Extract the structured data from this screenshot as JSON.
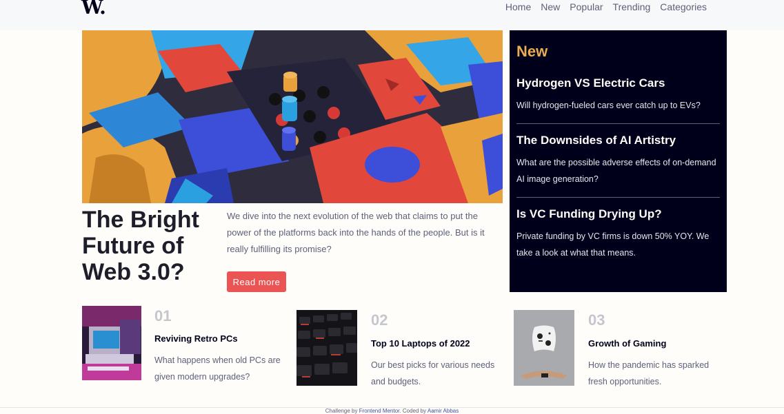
{
  "header": {
    "logo": "W.",
    "nav": [
      "Home",
      "New",
      "Popular",
      "Trending",
      "Categories"
    ]
  },
  "hero": {
    "title": "The Bright Future of Web 3.0?",
    "description": "We dive into the next evolution of the web that claims to put the power of the platforms back into the hands of the people. But is it really fulfilling its promise?",
    "button": "Read more"
  },
  "new_panel": {
    "heading": "New",
    "items": [
      {
        "title": "Hydrogen VS Electric Cars",
        "text": "Will hydrogen-fueled cars ever catch up to EVs?"
      },
      {
        "title": "The Downsides of AI Artistry",
        "text": "What are the possible adverse effects of on-demand AI image generation?"
      },
      {
        "title": "Is VC Funding Drying Up?",
        "text": "Private funding by VC firms is down 50% YOY. We take a look at what that means."
      }
    ]
  },
  "cards": [
    {
      "number": "01",
      "title": "Reviving Retro PCs",
      "text": "What happens when old PCs are given modern upgrades?"
    },
    {
      "number": "02",
      "title": "Top 10 Laptops of 2022",
      "text": "Our best picks for various needs and budgets."
    },
    {
      "number": "03",
      "title": "Growth of Gaming",
      "text": "How the pandemic has sparked fresh opportunities."
    }
  ],
  "footer": {
    "prefix": "Challenge by",
    "link1": "Frontend Mentor",
    "middle": ". Coded by",
    "link2": "Aamir Abbas"
  },
  "colors": {
    "accent_red": "#ea5454",
    "accent_orange": "#e9ab53",
    "dark_navy": "#00001a",
    "off_white": "#fffdfa",
    "muted_text": "#5e607a"
  }
}
